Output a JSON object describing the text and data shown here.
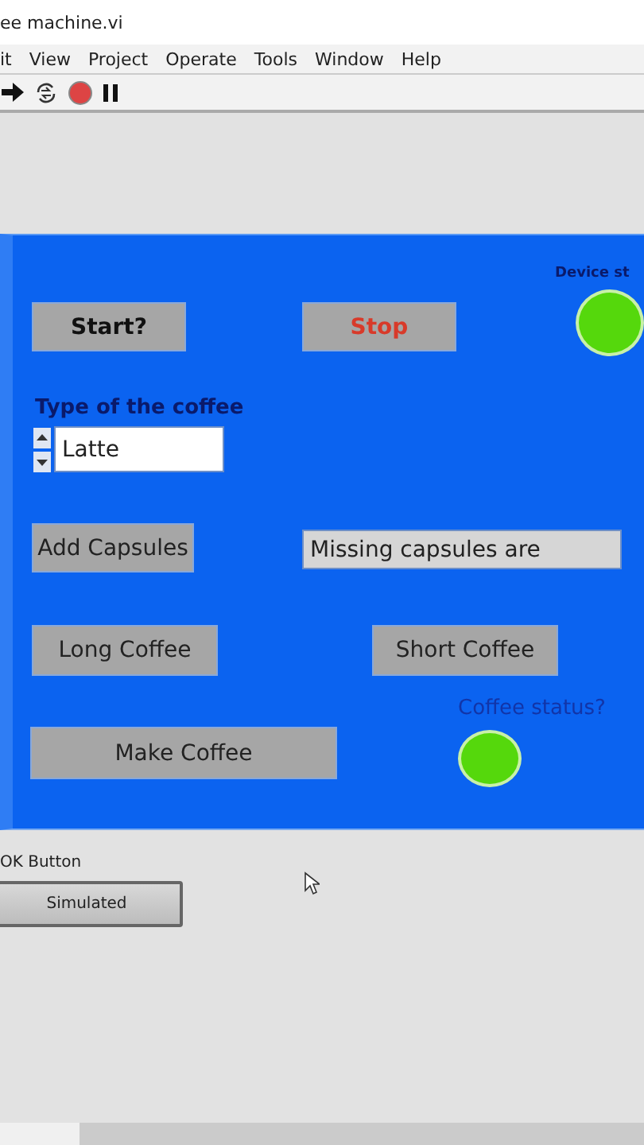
{
  "window": {
    "title": "ee machine.vi"
  },
  "menu": [
    "it",
    "View",
    "Project",
    "Operate",
    "Tools",
    "Window",
    "Help"
  ],
  "panel": {
    "start_button": {
      "label": "Start?"
    },
    "stop_button": {
      "label": "Stop"
    },
    "device_status": {
      "label": "Device st",
      "on": true
    },
    "coffee_type": {
      "label": "Type of the coffee",
      "value": "Latte"
    },
    "add_capsules_button": {
      "label": "Add Capsules"
    },
    "missing_capsules": {
      "value": "Missing capsules are"
    },
    "long_coffee_button": {
      "label": "Long Coffee"
    },
    "short_coffee_button": {
      "label": "Short Coffee"
    },
    "coffee_status": {
      "label": "Coffee status?",
      "on": true
    },
    "make_coffee_button": {
      "label": "Make Coffee"
    }
  },
  "ok_button": {
    "label": "OK Button",
    "caption": "Simulated"
  }
}
